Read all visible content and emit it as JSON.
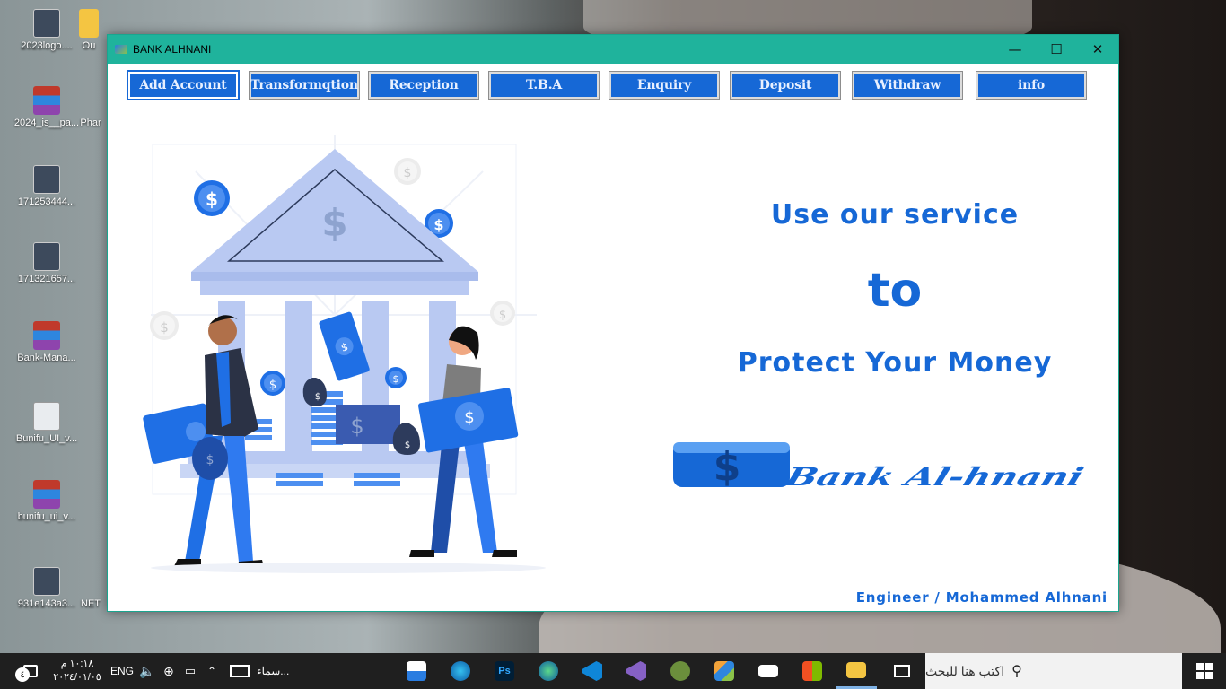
{
  "desktop": {
    "icons": [
      {
        "label": "2023logo....",
        "icon": "image-icon"
      },
      {
        "label": "Ou",
        "icon": "folder-icon"
      },
      {
        "label": "2024_is__pa...",
        "icon": "winrar-icon"
      },
      {
        "label": "Phar",
        "icon": "folder-icon"
      },
      {
        "label": "171253444...",
        "icon": "image-icon"
      },
      {
        "label": "171321657...",
        "icon": "image-icon"
      },
      {
        "label": "Bank-Mana...",
        "icon": "winrar-icon"
      },
      {
        "label": "Bunifu_UI_v...",
        "icon": "gear-icon"
      },
      {
        "label": "bunifu_ui_v...",
        "icon": "winrar-icon"
      },
      {
        "label": "931e143a3...",
        "icon": "image-icon"
      },
      {
        "label": "NET",
        "icon": "folder-icon"
      }
    ]
  },
  "window": {
    "title": "BANK ALHNANI",
    "controls": {
      "minimize": "—",
      "maximize": "☐",
      "close": "✕"
    }
  },
  "nav": {
    "buttons": [
      {
        "label": "Add Account"
      },
      {
        "label": "Transformqtion"
      },
      {
        "label": "Reception"
      },
      {
        "label": "T.B.A"
      },
      {
        "label": "Enquiry"
      },
      {
        "label": "Deposit"
      },
      {
        "label": "Withdraw"
      },
      {
        "label": "info"
      }
    ]
  },
  "hero": {
    "line1": "Use our service",
    "line2": "to",
    "line3": "Protect Your Money"
  },
  "logo": {
    "symbol": "$",
    "text": "Bank Al-hnani"
  },
  "footer": {
    "credit": "Engineer / Mohammed Alhnani"
  },
  "taskbar": {
    "search_placeholder": "اكتب هنا للبحث",
    "time": "١٠:١٨ م",
    "date": "٢٠٢٤/٠١/٠٥",
    "language": "ENG",
    "news": "سماء...",
    "notification_count": "٤"
  },
  "colors": {
    "accent": "#1668d6",
    "titlebar": "#1fb39c",
    "illustration_blue": "#1f6fe5",
    "illustration_light": "#b9c9f2"
  }
}
